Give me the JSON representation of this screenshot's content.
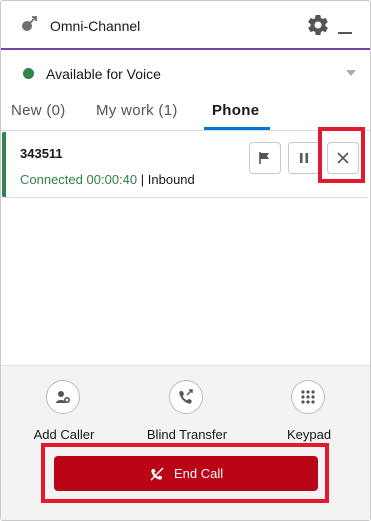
{
  "header": {
    "title": "Omni-Channel",
    "logo_icon": "omni-logo-icon",
    "settings_icon": "gear-icon",
    "minimize_icon": "minimize-icon",
    "accent_color": "#7b3fb0"
  },
  "status": {
    "label": "Available for Voice",
    "status_color": "#2e844a",
    "dropdown_icon": "chevron-down-icon"
  },
  "tabs": [
    {
      "label": "New (0)",
      "active": false
    },
    {
      "label": "My work (1)",
      "active": false
    },
    {
      "label": "Phone",
      "active": true
    }
  ],
  "work_item": {
    "number": "343511",
    "connected_label": "Connected",
    "timer": "00:00:40",
    "separator": "|",
    "direction": "Inbound",
    "buttons": [
      {
        "icon": "flag-icon"
      },
      {
        "icon": "pause-icon"
      },
      {
        "icon": "close-icon"
      }
    ]
  },
  "actions": [
    {
      "label": "Add Caller",
      "icon": "add-caller-icon"
    },
    {
      "label": "Blind Transfer",
      "icon": "blind-transfer-icon"
    },
    {
      "label": "Keypad",
      "icon": "keypad-icon"
    }
  ],
  "end_call": {
    "label": "End Call",
    "icon": "end-call-icon",
    "color": "#ba0517"
  },
  "highlight_color": "#e31a2d"
}
